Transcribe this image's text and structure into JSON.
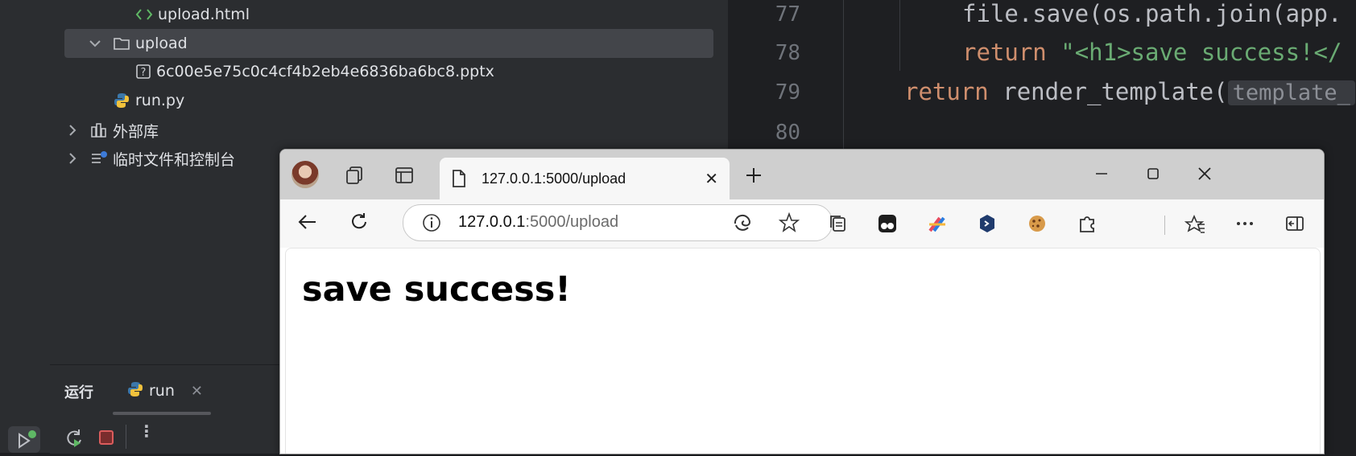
{
  "ide": {
    "tree": {
      "items": [
        {
          "label": "upload.html",
          "icon": "html-file-icon"
        },
        {
          "label": "upload",
          "icon": "folder-icon"
        },
        {
          "label": "6c00e5e75c0c4cf4b2eb4e6836ba6bc8.pptx",
          "icon": "unknown-file-icon"
        },
        {
          "label": "run.py",
          "icon": "python-file-icon"
        },
        {
          "label": "外部库",
          "icon": "library-icon"
        },
        {
          "label": "临时文件和控制台",
          "icon": "scratches-icon"
        }
      ]
    },
    "code": {
      "line_numbers": [
        "77",
        "78",
        "79",
        "80"
      ],
      "line77": "file.save(os.path.join(app.",
      "line78_kw": "return",
      "line78_str": "\"<h1>save success!</",
      "line79_kw": "return",
      "line79_call": "render_template(",
      "line79_hint": "template_"
    },
    "run_panel": {
      "title": "运行",
      "tab_label": "run"
    }
  },
  "browser": {
    "tab_title": "127.0.0.1:5000/upload",
    "url_host": "127.0.0.1",
    "url_rest": ":5000/upload",
    "page_heading": "save success!"
  }
}
